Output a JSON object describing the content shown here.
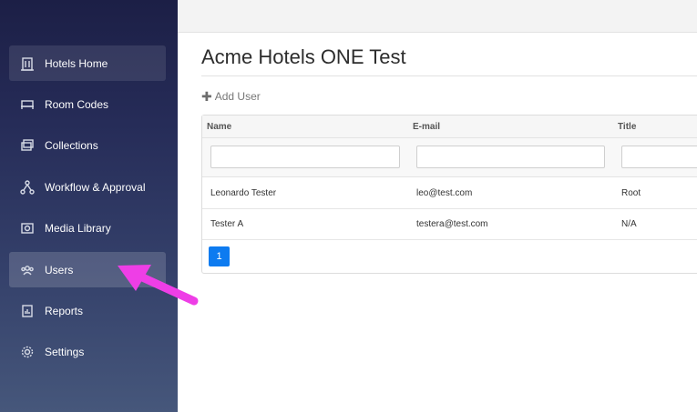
{
  "sidebar": {
    "items": [
      {
        "label": "Hotels Home",
        "icon": "building-icon"
      },
      {
        "label": "Room Codes",
        "icon": "bed-icon"
      },
      {
        "label": "Collections",
        "icon": "images-icon"
      },
      {
        "label": "Workflow & Approval",
        "icon": "workflow-icon"
      },
      {
        "label": "Media Library",
        "icon": "media-icon"
      },
      {
        "label": "Users",
        "icon": "users-icon"
      },
      {
        "label": "Reports",
        "icon": "report-icon"
      },
      {
        "label": "Settings",
        "icon": "gear-icon"
      }
    ]
  },
  "main": {
    "title": "Acme Hotels ONE Test",
    "add_user_label": "Add User",
    "table": {
      "headers": [
        "Name",
        "E-mail",
        "Title"
      ],
      "rows": [
        [
          "Leonardo Tester",
          "leo@test.com",
          "Root"
        ],
        [
          "Tester A",
          "testera@test.com",
          "N/A"
        ]
      ],
      "current_page": "1"
    }
  },
  "colors": {
    "sidebar_top": "#1c1f46",
    "sidebar_bottom": "#46577b",
    "pager_active": "#0d7bf0",
    "annotation_arrow": "#ee3ee6"
  }
}
